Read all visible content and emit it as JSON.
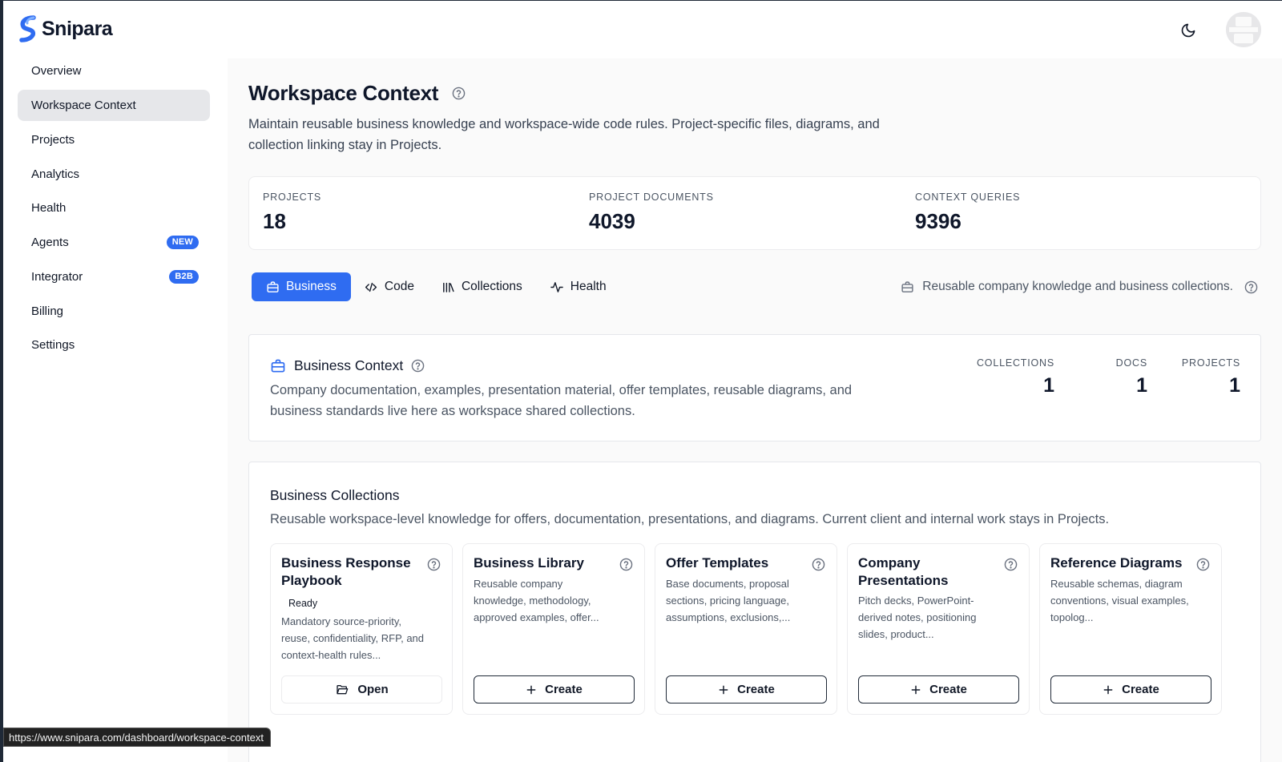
{
  "app": {
    "name": "Snipara"
  },
  "sidebar": {
    "items": [
      {
        "label": "Overview",
        "active": false
      },
      {
        "label": "Workspace Context",
        "active": true
      },
      {
        "label": "Projects",
        "active": false
      },
      {
        "label": "Analytics",
        "active": false
      },
      {
        "label": "Health",
        "active": false
      },
      {
        "label": "Agents",
        "active": false,
        "badge": "NEW"
      },
      {
        "label": "Integrator",
        "active": false,
        "badge": "B2B"
      },
      {
        "label": "Billing",
        "active": false
      },
      {
        "label": "Settings",
        "active": false
      }
    ]
  },
  "page": {
    "title": "Workspace Context",
    "description": "Maintain reusable business knowledge and workspace-wide code rules. Project-specific files, diagrams, and collection linking stay in Projects."
  },
  "stats": [
    {
      "label": "PROJECTS",
      "value": "18"
    },
    {
      "label": "PROJECT DOCUMENTS",
      "value": "4039"
    },
    {
      "label": "CONTEXT QUERIES",
      "value": "9396"
    }
  ],
  "tabs": [
    {
      "label": "Business",
      "icon": "briefcase-icon",
      "active": true
    },
    {
      "label": "Code",
      "icon": "code-icon",
      "active": false
    },
    {
      "label": "Collections",
      "icon": "library-icon",
      "active": false
    },
    {
      "label": "Health",
      "icon": "activity-icon",
      "active": false
    }
  ],
  "tab_hint": "Reusable company knowledge and business collections.",
  "business_context": {
    "title": "Business Context",
    "description": "Company documentation, examples, presentation material, offer templates, reusable diagrams, and business standards live here as workspace shared collections.",
    "stats": [
      {
        "label": "COLLECTIONS",
        "value": "1"
      },
      {
        "label": "DOCS",
        "value": "1"
      },
      {
        "label": "PROJECTS",
        "value": "1"
      }
    ]
  },
  "business_collections": {
    "title": "Business Collections",
    "description": "Reusable workspace-level knowledge for offers, documentation, presentations, and diagrams. Current client and internal work stays in Projects.",
    "cards": [
      {
        "title": "Business Response Playbook",
        "status": "Ready",
        "description": "Mandatory source-priority, reuse, confidentiality, RFP, and context-health rules...",
        "action": "Open"
      },
      {
        "title": "Business Library",
        "status": "",
        "description": "Reusable company knowledge, methodology, approved examples, offer...",
        "action": "Create"
      },
      {
        "title": "Offer Templates",
        "status": "",
        "description": "Base documents, proposal sections, pricing language, assumptions, exclusions,...",
        "action": "Create"
      },
      {
        "title": "Company Presentations",
        "status": "",
        "description": "Pitch decks, PowerPoint-derived notes, positioning slides, product...",
        "action": "Create"
      },
      {
        "title": "Reference Diagrams",
        "status": "",
        "description": "Reusable schemas, diagram conventions, visual examples, topolog...",
        "action": "Create"
      }
    ]
  },
  "status_bar": {
    "url": "https://www.snipara.com/dashboard/workspace-context"
  },
  "colors": {
    "accent": "#2f6cf1",
    "text": "#0f172a",
    "muted": "#4b5563"
  }
}
